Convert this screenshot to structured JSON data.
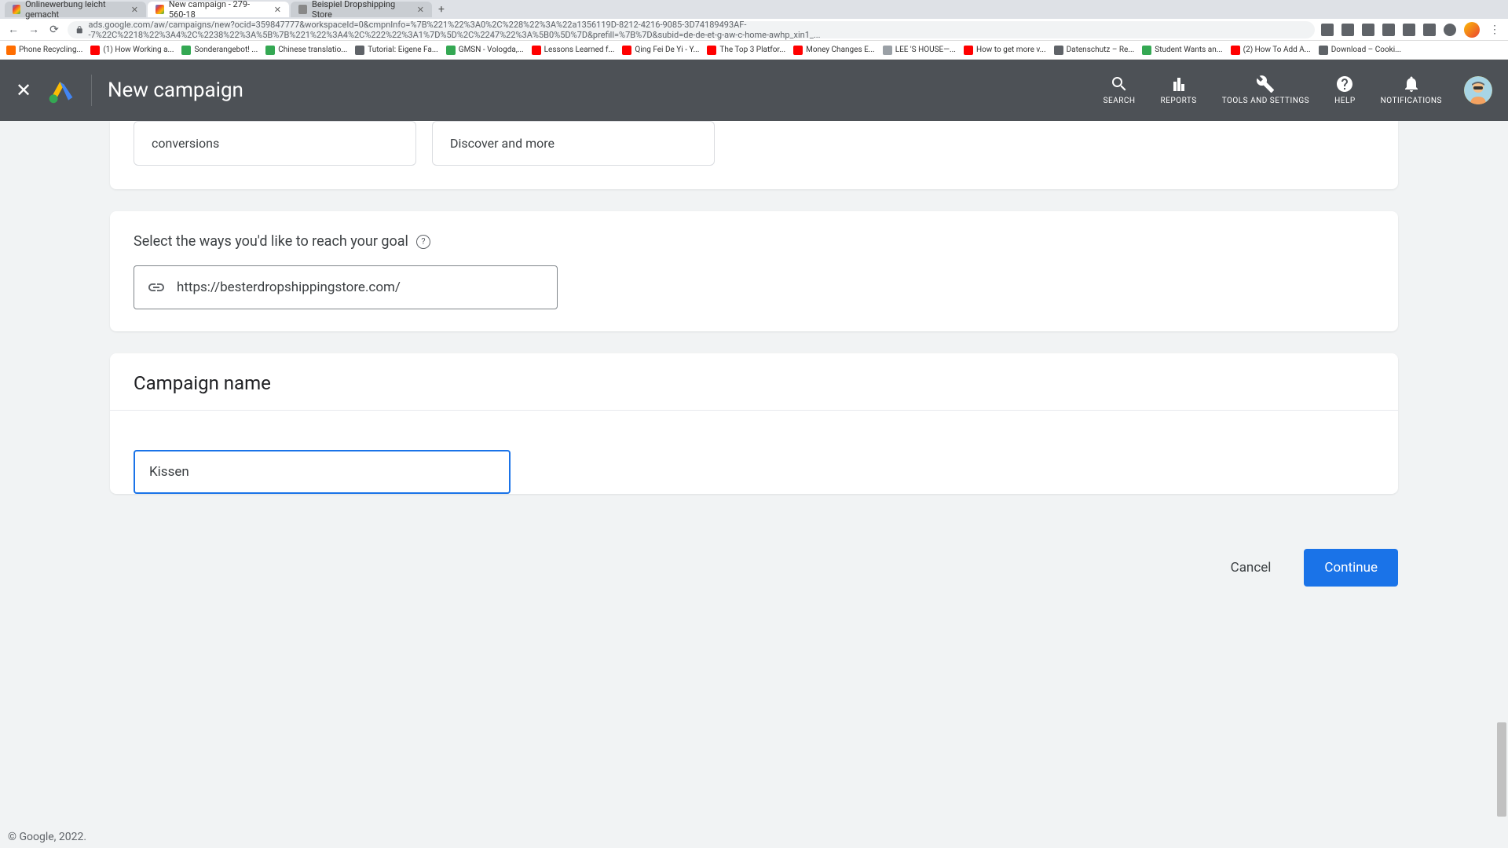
{
  "browser": {
    "tabs": [
      {
        "title": "Onlinewerbung leicht gemacht",
        "favicon": "google"
      },
      {
        "title": "New campaign - 279-560-18",
        "favicon": "google",
        "active": true
      },
      {
        "title": "Beispiel Dropshipping Store",
        "favicon": "gray"
      }
    ],
    "url": "ads.google.com/aw/campaigns/new?ocid=359847777&workspaceId=0&cmpnInfo=%7B%221%22%3A0%2C%228%22%3A%22a1356119D-8212-4216-9085-3D74189493AF--7%22C%2218%22%3A4%2C%2238%22%3A%5B%7B%221%22%3A4%2C%222%22%3A1%7D%5D%2C%2247%22%3A%5B0%5D%7D&prefill=%7B%7D&subid=de-de-et-g-aw-c-home-awhp_xin1_...",
    "bookmarks": [
      {
        "label": "Phone Recycling...",
        "color": "#ff6d00"
      },
      {
        "label": "(1) How Working a...",
        "color": "#ff0000"
      },
      {
        "label": "Sonderangebot! ...",
        "color": "#34a853"
      },
      {
        "label": "Chinese translatio...",
        "color": "#34a853"
      },
      {
        "label": "Tutorial: Eigene Fa...",
        "color": "#5f6368"
      },
      {
        "label": "GMSN - Vologda,...",
        "color": "#34a853"
      },
      {
        "label": "Lessons Learned f...",
        "color": "#ff0000"
      },
      {
        "label": "Qing Fei De Yi - Y...",
        "color": "#ff0000"
      },
      {
        "label": "The Top 3 Platfor...",
        "color": "#ff0000"
      },
      {
        "label": "Money Changes E...",
        "color": "#ff0000"
      },
      {
        "label": "LEE 'S HOUSE—...",
        "color": "#9aa0a6"
      },
      {
        "label": "How to get more v...",
        "color": "#ff0000"
      },
      {
        "label": "Datenschutz – Re...",
        "color": "#5f6368"
      },
      {
        "label": "Student Wants an...",
        "color": "#34a853"
      },
      {
        "label": "(2) How To Add A...",
        "color": "#ff0000"
      },
      {
        "label": "Download – Cooki...",
        "color": "#5f6368"
      }
    ]
  },
  "header": {
    "title": "New campaign",
    "tools": {
      "search": "SEARCH",
      "reports": "REPORTS",
      "tools_settings": "TOOLS AND SETTINGS",
      "help": "HELP",
      "notifications": "NOTIFICATIONS"
    }
  },
  "partial_options": {
    "left": "conversions",
    "right": "Discover and more"
  },
  "reach_goal": {
    "label": "Select the ways you'd like to reach your goal",
    "url": "https://besterdropshippingstore.com/"
  },
  "campaign_name": {
    "title": "Campaign name",
    "value": "Kissen "
  },
  "actions": {
    "cancel": "Cancel",
    "continue": "Continue"
  },
  "footer": "© Google, 2022."
}
